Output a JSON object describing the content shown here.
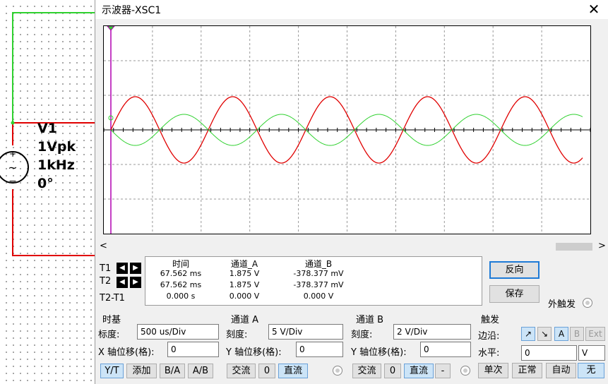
{
  "schematic": {
    "source_name": "V1",
    "source_amplitude": "1Vpk",
    "source_freq": "1kHz",
    "source_phase": "0°",
    "plus": "+",
    "minus": "−",
    "tilde": "~"
  },
  "window": {
    "title": "示波器-XSC1",
    "close": "✕"
  },
  "traces": {
    "channel_a_color": "#e00000",
    "channel_b_color": "#2fd12f",
    "cursor_color": "#b000b0"
  },
  "scroll": {
    "left_arrow": "<",
    "right_arrow": ">"
  },
  "readout": {
    "headers": [
      "时间",
      "通道_A",
      "通道_B"
    ],
    "rows": [
      {
        "label": "T1",
        "time": "67.562 ms",
        "a": "1.875 V",
        "b": "-378.377 mV"
      },
      {
        "label": "T2",
        "time": "67.562 ms",
        "a": "1.875 V",
        "b": "-378.377 mV"
      },
      {
        "label": "T2-T1",
        "time": "0.000 s",
        "a": "0.000 V",
        "b": "0.000 V"
      }
    ],
    "left_arrow": "◀",
    "right_arrow": "▶"
  },
  "actions": {
    "reverse": "反向",
    "save": "保存",
    "ext_trigger": "外触发"
  },
  "timebase": {
    "title": "时基",
    "scale_label": "标度:",
    "scale_value": "500 us/Div",
    "xpos_label": "X 轴位移(格):",
    "xpos_value": "0",
    "modes": [
      "Y/T",
      "添加",
      "B/A",
      "A/B"
    ]
  },
  "channel_a": {
    "title": "通道 A",
    "scale_label": "刻度:",
    "scale_value": "5  V/Div",
    "ypos_label": "Y 轴位移(格):",
    "ypos_value": "0",
    "coupling": [
      "交流",
      "0",
      "直流"
    ]
  },
  "channel_b": {
    "title": "通道 B",
    "scale_label": "刻度:",
    "scale_value": "2  V/Div",
    "ypos_label": "Y 轴位移(格):",
    "ypos_value": "0",
    "coupling": [
      "交流",
      "0",
      "直流",
      "-"
    ]
  },
  "trigger": {
    "title": "触发",
    "edge_label": "边沿:",
    "edge_rise": "↗",
    "edge_fall": "↘",
    "sources": [
      "A",
      "B",
      "Ext"
    ],
    "level_label": "水平:",
    "level_value": "0",
    "level_unit": "V",
    "modes": [
      "单次",
      "正常",
      "自动",
      "无"
    ]
  }
}
